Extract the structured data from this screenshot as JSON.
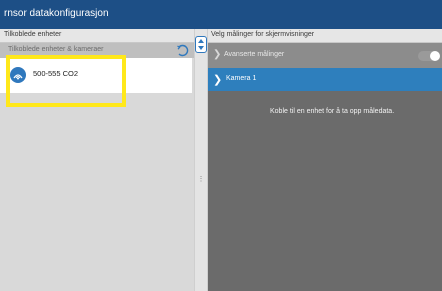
{
  "window": {
    "title": "rnsor datakonfigurasjon"
  },
  "devices_panel": {
    "header": "Tilkoblede enheter",
    "group_label": "Tilkoblede enheter & kameraer",
    "devices": [
      {
        "label": "500-555 CO2",
        "icon": "sensor-device-icon"
      }
    ]
  },
  "measurements_panel": {
    "header": "Velg målinger for skjermvisninger",
    "filter_label": "Avanserte målinger",
    "selected_item": "Kamera 1",
    "hint": "Koble til en enhet for å ta opp måledata."
  },
  "annotation": {
    "highlight_color": "#ffe81a"
  },
  "colors": {
    "accent": "#2e7fbd",
    "title_bar": "#1d4f86"
  }
}
